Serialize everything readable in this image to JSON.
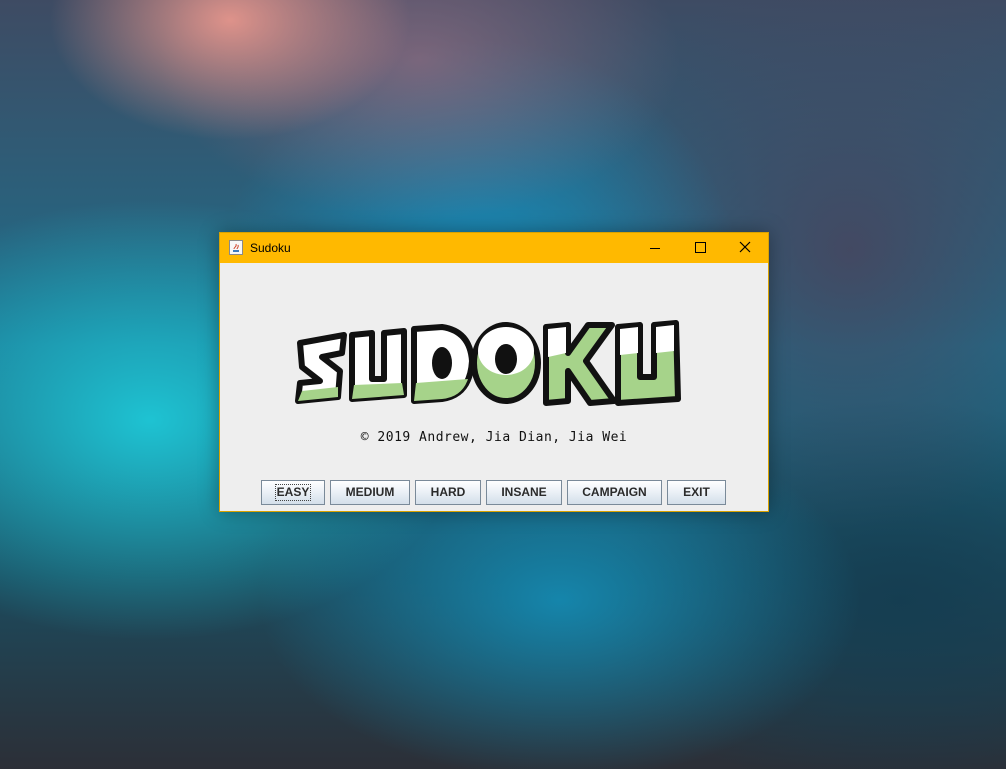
{
  "window": {
    "title": "Sudoku",
    "titlebar_color": "#ffb900",
    "controls": {
      "minimize_icon": "minimize-icon",
      "maximize_icon": "maximize-icon",
      "close_icon": "close-icon"
    }
  },
  "logo": {
    "text": "SUDOKU",
    "colors": {
      "fill_white": "#ffffff",
      "fill_green": "#a6d38a",
      "outline": "#111111"
    }
  },
  "credits": "© 2019 Andrew, Jia Dian, Jia Wei",
  "buttons": {
    "easy": "EASY",
    "medium": "MEDIUM",
    "hard": "HARD",
    "insane": "INSANE",
    "campaign": "CAMPAIGN",
    "exit": "EXIT"
  }
}
